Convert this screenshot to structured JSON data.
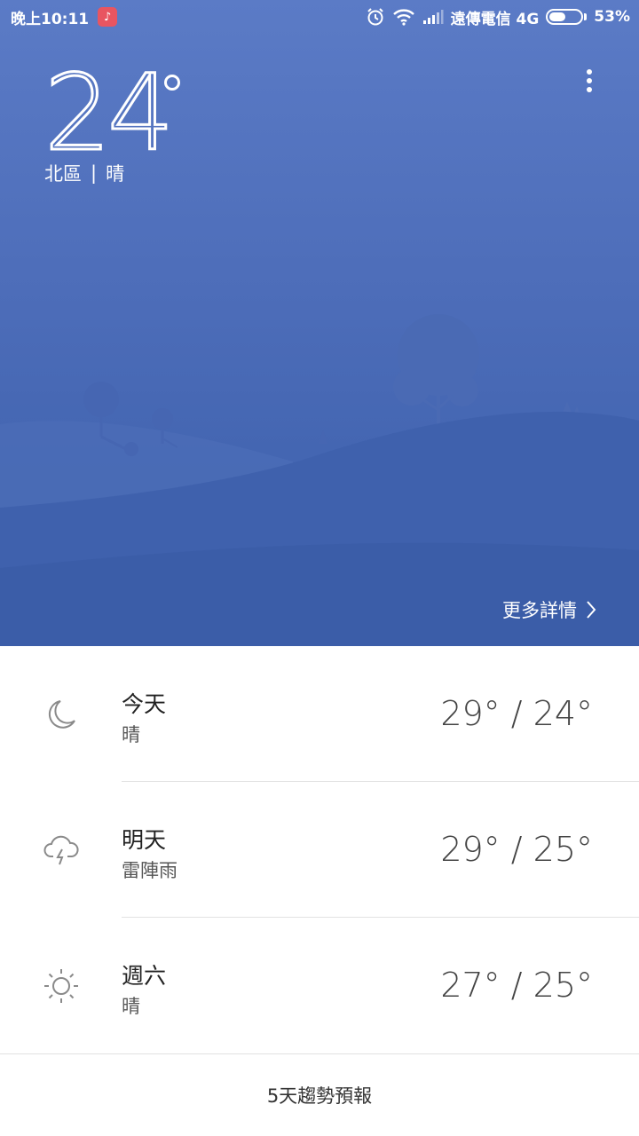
{
  "status_bar": {
    "time": "晚上10:11",
    "carrier": "遠傳電信 4G",
    "battery_percent": "53%",
    "battery_level": 0.53
  },
  "current": {
    "temperature": "24",
    "location": "北區",
    "separator": "|",
    "condition": "晴"
  },
  "details_link": "更多詳情",
  "forecast": [
    {
      "day": "今天",
      "condition": "晴",
      "temp": "29° / 24°",
      "icon": "moon-icon"
    },
    {
      "day": "明天",
      "condition": "雷陣雨",
      "temp": "29° / 25°",
      "icon": "thunderstorm-icon"
    },
    {
      "day": "週六",
      "condition": "晴",
      "temp": "27° / 25°",
      "icon": "sun-icon"
    }
  ],
  "trend_label": "5天趨勢預報",
  "colors": {
    "sky_top": "#5b7bc6",
    "sky_bottom": "#3a5da8",
    "icon_gray": "#8a8a8a"
  }
}
